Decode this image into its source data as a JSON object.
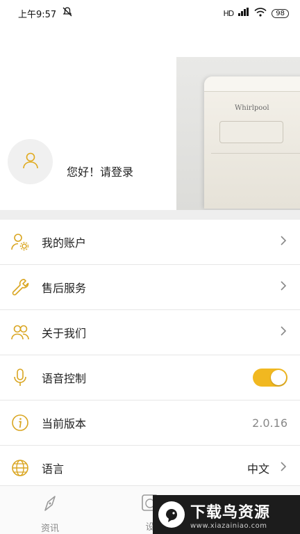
{
  "status_bar": {
    "time": "上午9:57",
    "signal_text": "HD",
    "battery": "98"
  },
  "header": {
    "login_prompt": "您好！请登录",
    "brand_logo": "Whirlpool"
  },
  "menu": {
    "items": [
      {
        "label": "我的账户",
        "icon": "user-gear-icon"
      },
      {
        "label": "售后服务",
        "icon": "wrench-icon"
      },
      {
        "label": "关于我们",
        "icon": "users-icon"
      },
      {
        "label": "语音控制",
        "icon": "microphone-icon",
        "toggle_on": true
      },
      {
        "label": "当前版本",
        "icon": "info-icon",
        "value": "2.0.16"
      },
      {
        "label": "语言",
        "icon": "globe-icon",
        "value": "中文"
      }
    ]
  },
  "bottom_nav": {
    "items": [
      {
        "label": "资讯",
        "icon": "compass-icon"
      },
      {
        "label": "设",
        "icon": "device-icon"
      },
      {
        "label": "",
        "icon": "profile-icon"
      }
    ]
  },
  "watermark": {
    "title": "下载鸟资源",
    "url": "www.xiazainiao.com"
  },
  "colors": {
    "accent": "#f1b820",
    "icon_stroke": "#d9a520",
    "divider": "#eeeeee"
  }
}
